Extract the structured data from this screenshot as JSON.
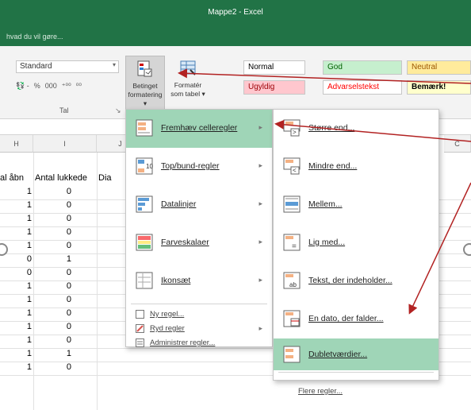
{
  "window": {
    "title": "Mappe2 - Excel",
    "tell_me": "hvad du vil gøre..."
  },
  "ribbon": {
    "number_format": "Standard",
    "number_buttons": [
      "💱 -",
      "%",
      "000",
      "⁺⁰⁰",
      "⁰⁰"
    ],
    "group_label": "Tal",
    "conditional_formatting": {
      "line1": "Betinget",
      "line2": "formatering ▾"
    },
    "format_as_table": {
      "line1": "Formatér",
      "line2": "som tabel ▾"
    },
    "styles": [
      {
        "label": "Normal",
        "bg": "#ffffff",
        "color": "#000000"
      },
      {
        "label": "God",
        "bg": "#c6efce",
        "color": "#006100"
      },
      {
        "label": "Neutral",
        "bg": "#ffeb9c",
        "color": "#9c5700"
      },
      {
        "label": "Ugyldig",
        "bg": "#ffc7ce",
        "color": "#9c0006"
      },
      {
        "label": "Advarselstekst",
        "bg": "#ffffff",
        "color": "#ff0000"
      },
      {
        "label": "Bemærk!",
        "bg": "#ffffcc",
        "color": "#000000"
      }
    ]
  },
  "grid": {
    "columns": [
      "H",
      "I",
      "J",
      "C"
    ],
    "headers": [
      "al åbn",
      "Antal lukkede",
      "Dia"
    ],
    "rows": [
      [
        "1",
        "0"
      ],
      [
        "1",
        "0"
      ],
      [
        "1",
        "0"
      ],
      [
        "1",
        "0"
      ],
      [
        "1",
        "0"
      ],
      [
        "0",
        "1"
      ],
      [
        "0",
        "0"
      ],
      [
        "1",
        "0"
      ],
      [
        "1",
        "0"
      ],
      [
        "1",
        "0"
      ],
      [
        "1",
        "0"
      ],
      [
        "1",
        "0"
      ],
      [
        "1",
        "1"
      ],
      [
        "1",
        "0"
      ]
    ]
  },
  "menu_main": {
    "items": [
      {
        "label": "Fremhæv celleregler",
        "icon": "highlight-rules-icon"
      },
      {
        "label": "Top/bund-regler",
        "icon": "top-bottom-icon"
      },
      {
        "label": "Datalinjer",
        "icon": "data-bars-icon"
      },
      {
        "label": "Farveskalaer",
        "icon": "color-scales-icon"
      },
      {
        "label": "Ikonsæt",
        "icon": "icon-sets-icon"
      }
    ],
    "small_items": [
      "Ny regel...",
      "Ryd regler",
      "Administrer regler..."
    ]
  },
  "menu_sub": {
    "items": [
      "Større end...",
      "Mindre end...",
      "Mellem...",
      "Lig med...",
      "Tekst, der indeholder...",
      "En dato, der falder...",
      "Dubletværdier..."
    ],
    "more": "Flere regler..."
  },
  "colors": {
    "excel_green": "#217346",
    "highlight": "#9fd5b7",
    "annotation_arrow": "#b22222"
  }
}
